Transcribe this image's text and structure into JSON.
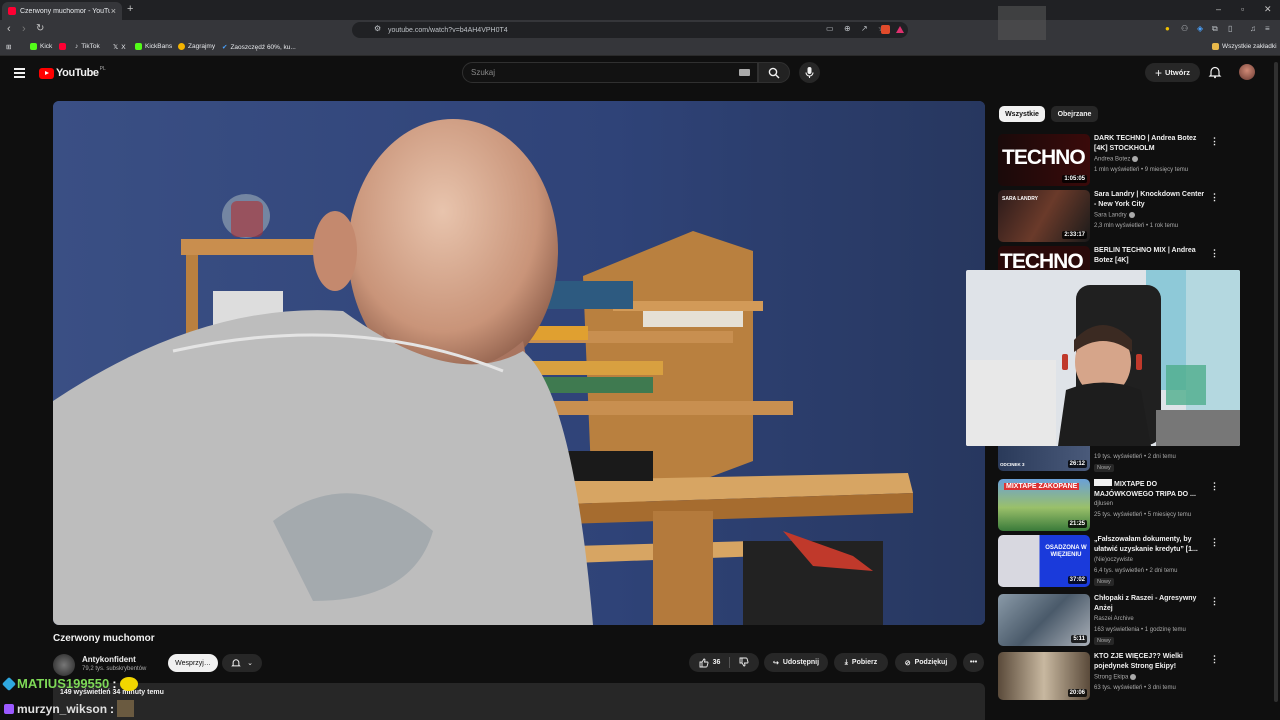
{
  "browser": {
    "tab_title": "Czerwony muchomor - YouTube",
    "url": "youtube.com/watch?v=b4AH4VPH0T4",
    "bookmarks": [
      "Kick",
      "TikTok",
      "X",
      "KickBans",
      "Zagrajmy",
      "Zaoszczędź 60%, ku..."
    ],
    "all_bookmarks": "Wszystkie zakładki"
  },
  "header": {
    "logo": "YouTube",
    "region": "PL",
    "search_placeholder": "Szukaj",
    "create_label": "Utwórz"
  },
  "video": {
    "title": "Czerwony muchomor",
    "channel": "Antykonfident",
    "subscribers": "79,2 tys. subskrybentów",
    "support_label": "Wesprzyj",
    "likes": "36",
    "share_label": "Udostępnij",
    "download_label": "Pobierz",
    "thanks_label": "Podziękuj",
    "views_time": "149 wyświetleń  34 minuty temu"
  },
  "chat": [
    {
      "user": "MATIUS199550",
      "color": "#7ed957",
      "message": ":"
    },
    {
      "user": "murzyn_wikson",
      "color": "#e0e0e0",
      "message": ":"
    }
  ],
  "sidebar": {
    "chips": [
      "Wszystkie",
      "Obejrzane"
    ],
    "items": [
      {
        "title": "DARK TECHNO | Andrea Botez [4K] STOCKHOLM",
        "channel": "Andrea Botez",
        "verified": true,
        "meta": "1 mln wyświetleń • 9 miesięcy temu",
        "duration": "1:05:05",
        "badge": "",
        "thumb_text": "TECHNO"
      },
      {
        "title": "Sara Landry | Knockdown Center - New York City",
        "channel": "Sara Landry",
        "verified": true,
        "meta": "2,3 mln wyświetleń • 1 rok temu",
        "duration": "2:33:17",
        "badge": "",
        "thumb_text": "SARA LANDRY"
      },
      {
        "title": "BERLIN TECHNO MIX | Andrea Botez [4K]",
        "channel": "",
        "verified": false,
        "meta": "",
        "duration": "",
        "badge": "",
        "thumb_text": "TECHNO"
      },
      {
        "title": "",
        "channel": "",
        "verified": false,
        "meta": "19 tys. wyświetleń • 2 dni temu",
        "duration": "26:12",
        "badge": "Nowy",
        "thumb_text": "ODCINEK 3"
      },
      {
        "title": "MIXTAPE DO MAJÓWKOWEGO TRIPA DO ...",
        "channel": "djlusen",
        "verified": false,
        "meta": "25 tys. wyświetleń • 5 miesięcy temu",
        "duration": "21:25",
        "badge": "",
        "thumb_text": "MIXTAPE ZAKOPANE"
      },
      {
        "title": "„Fałszowałam dokumenty, by ułatwić uzyskanie kredytu” [1...",
        "channel": "(Nie)oczywiste",
        "verified": false,
        "meta": "6,4 tys. wyświetleń • 2 dni temu",
        "duration": "37:02",
        "badge": "Nowy",
        "thumb_text": "OSADZONA W WIĘZIENIU"
      },
      {
        "title": "Chłopaki z Raszei - Agresywny Anżej",
        "channel": "Raszei Archive",
        "verified": false,
        "meta": "163 wyświetlenia • 1 godzinę temu",
        "duration": "5:11",
        "badge": "Nowy",
        "thumb_text": ""
      },
      {
        "title": "KTO ZJE WIĘCEJ?? Wielki pojedynek Strong Ekipy!",
        "channel": "Strong Ekipa",
        "verified": true,
        "meta": "63 tys. wyświetleń • 3 dni temu",
        "duration": "20:06",
        "badge": "",
        "thumb_text": ""
      }
    ]
  }
}
